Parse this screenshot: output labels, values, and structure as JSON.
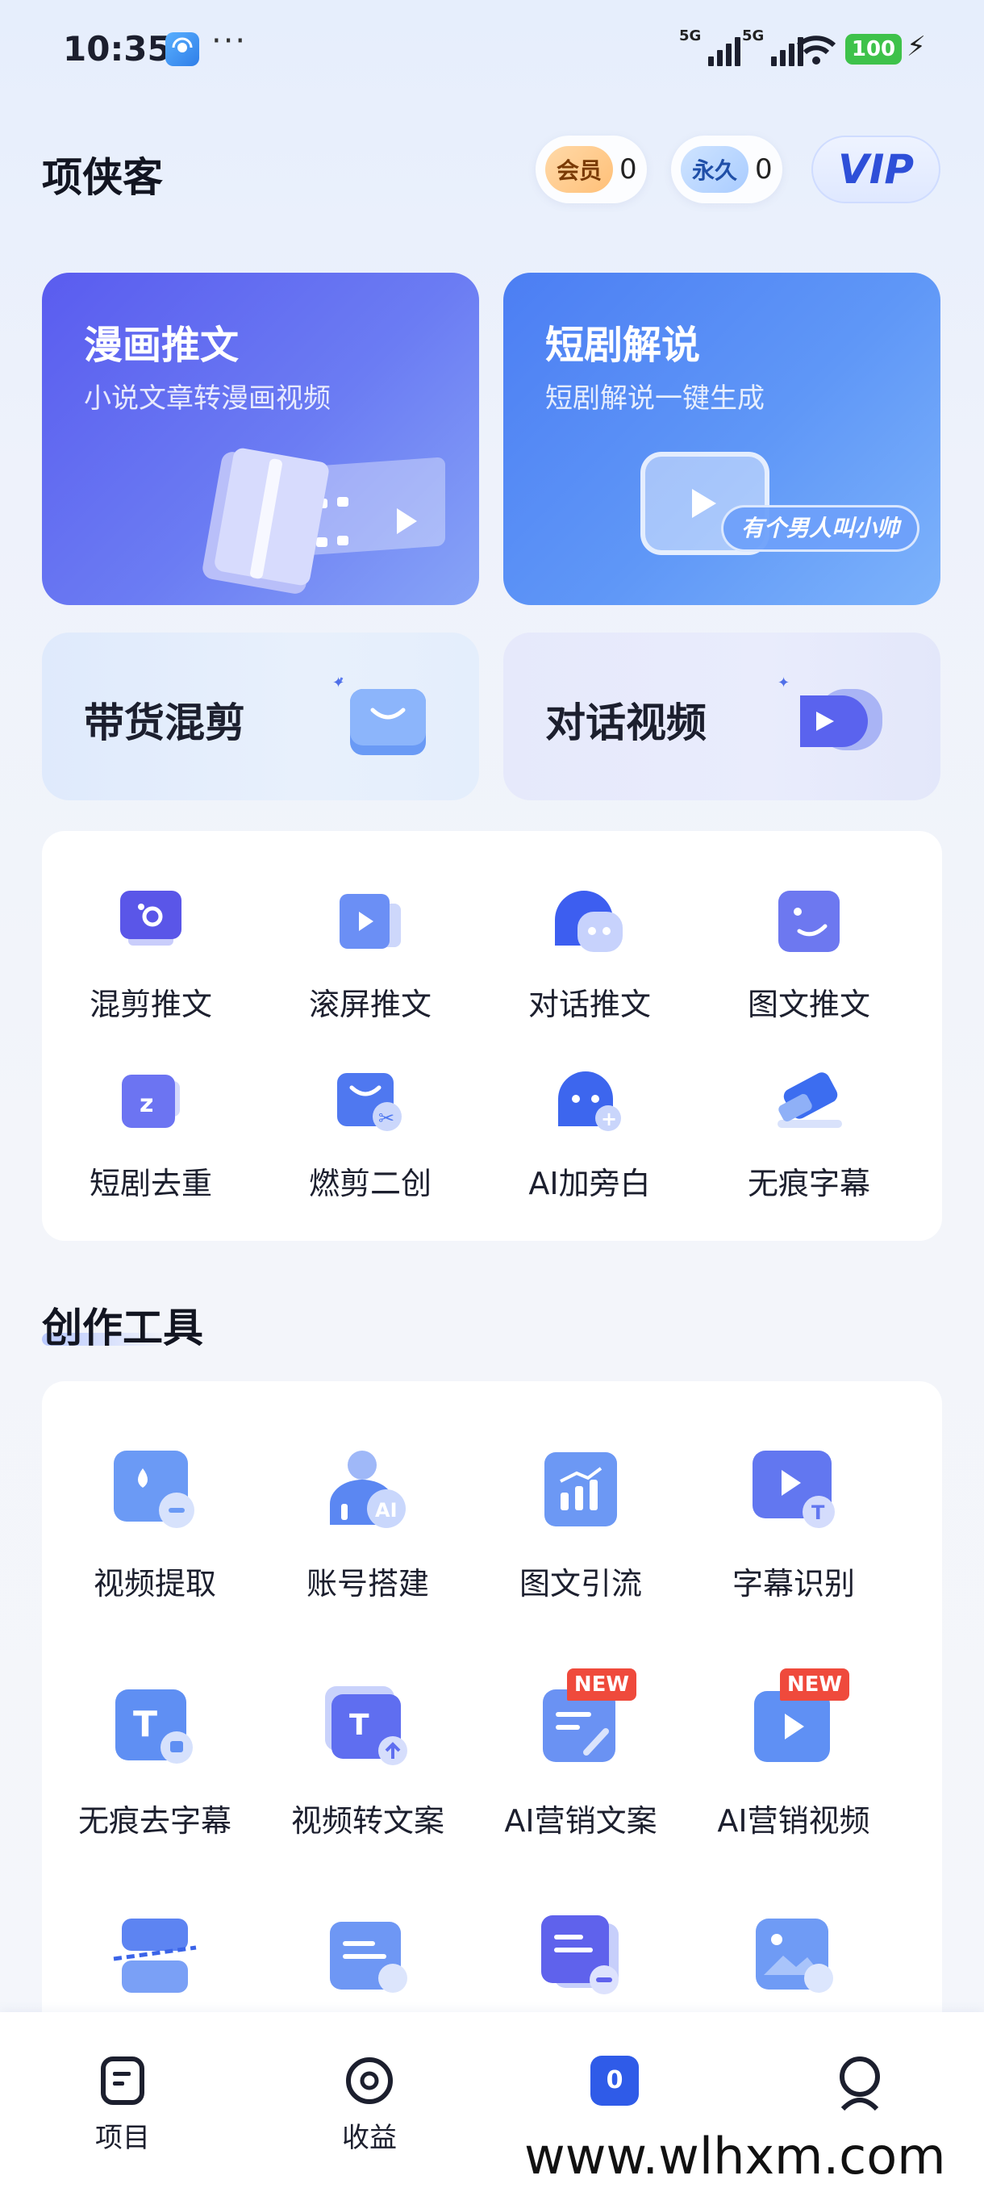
{
  "status_bar": {
    "time": "10:35",
    "dots": "···",
    "network1": "5G",
    "network2": "5G",
    "battery": "100"
  },
  "header": {
    "title": "项侠客",
    "member_label": "会员",
    "member_count": "0",
    "forever_label": "永久",
    "forever_count": "0",
    "vip_label": "VIP"
  },
  "features": {
    "comic": {
      "title": "漫画推文",
      "subtitle": "小说文章转漫画视频"
    },
    "drama": {
      "title": "短剧解说",
      "subtitle": "短剧解说一键生成",
      "bubble_text": "有个男人叫小帅"
    },
    "goods": {
      "title": "带货混剪"
    },
    "dialog": {
      "title": "对话视频"
    }
  },
  "quick_tools": [
    {
      "label": "混剪推文",
      "icon": "mix-icon"
    },
    {
      "label": "滚屏推文",
      "icon": "scroll-icon"
    },
    {
      "label": "对话推文",
      "icon": "chat-icon"
    },
    {
      "label": "图文推文",
      "icon": "image-text-icon"
    },
    {
      "label": "短剧去重",
      "icon": "dedupe-icon"
    },
    {
      "label": "燃剪二创",
      "icon": "cut-icon"
    },
    {
      "label": "AI加旁白",
      "icon": "narration-icon"
    },
    {
      "label": "无痕字幕",
      "icon": "eraser-icon"
    }
  ],
  "creation_tools": {
    "title": "创作工具",
    "items": [
      {
        "label": "视频提取",
        "icon": "extract-icon"
      },
      {
        "label": "账号搭建",
        "icon": "account-ai-icon"
      },
      {
        "label": "图文引流",
        "icon": "chart-icon"
      },
      {
        "label": "字幕识别",
        "icon": "subtitle-recognize-icon"
      },
      {
        "label": "无痕去字幕",
        "icon": "remove-subtitle-icon"
      },
      {
        "label": "视频转文案",
        "icon": "video-to-text-icon"
      },
      {
        "label": "AI营销文案",
        "icon": "marketing-copy-icon",
        "badge": "NEW"
      },
      {
        "label": "AI营销视频",
        "icon": "marketing-video-icon",
        "badge": "NEW"
      }
    ]
  },
  "tabbar": {
    "items": [
      {
        "label": "项目",
        "icon": "project-icon"
      },
      {
        "label": "收益",
        "icon": "earnings-icon"
      },
      {
        "label": "",
        "icon": "tools-icon",
        "badge": "0"
      },
      {
        "label": "",
        "icon": "profile-icon"
      }
    ]
  },
  "watermark": "www.wlhxm.com",
  "colors": {
    "accent": "#3f6df0",
    "comic_card": "#5b6cf0",
    "drama_card": "#4f8df5",
    "new_badge": "#ef4a3c",
    "battery": "#3ec24a"
  }
}
